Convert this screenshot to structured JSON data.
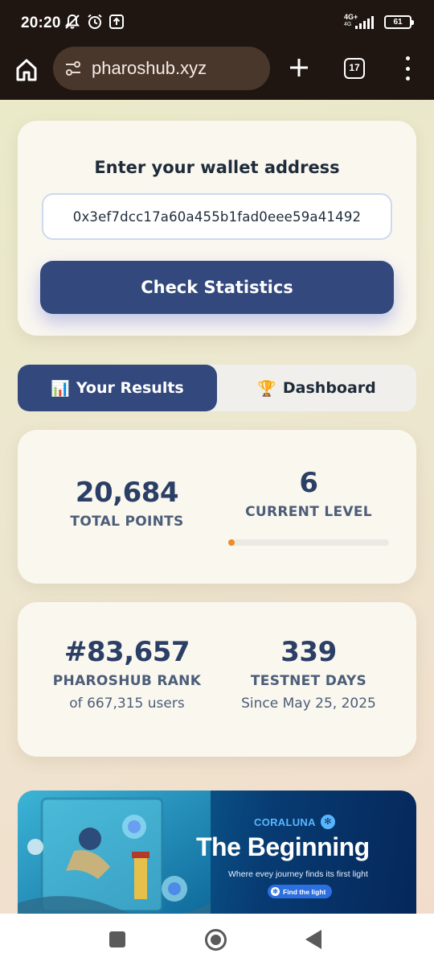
{
  "status_bar": {
    "time": "20:20",
    "network_label": "4G+",
    "network_sub": "4G",
    "battery": "61",
    "icons": [
      "notifications-off-icon",
      "alarm-icon",
      "upload-notification-icon",
      "signal-icon",
      "battery-icon"
    ]
  },
  "browser": {
    "url": "pharoshub.xyz",
    "tab_count": "17",
    "icons": [
      "home-icon",
      "site-settings-icon",
      "plus-icon",
      "tab-switcher-icon",
      "more-menu-icon"
    ]
  },
  "wallet": {
    "title": "Enter your wallet address",
    "address": "0x3ef7dcc17a60a455b1fad0eee59a41492",
    "button_label": "Check Statistics"
  },
  "tabs": [
    {
      "icon": "📊",
      "label": "Your Results",
      "active": true
    },
    {
      "icon": "🏆",
      "label": "Dashboard",
      "active": false
    }
  ],
  "stats": {
    "total_points": {
      "value": "20,684",
      "label": "TOTAL POINTS"
    },
    "current_level": {
      "value": "6",
      "label": "CURRENT LEVEL",
      "progress": 0.02
    },
    "rank": {
      "value": "#83,657",
      "label": "PHAROSHUB RANK",
      "sub": "of 667,315 users"
    },
    "testnet_days": {
      "value": "339",
      "label": "TESTNET DAYS",
      "sub": "Since May 25, 2025"
    }
  },
  "banner": {
    "brand": "CORALUNA",
    "title": "The Beginning",
    "tagline": "Where evey journey finds its first  light",
    "button_label": "Find the light"
  },
  "colors": {
    "primary": "#33497d",
    "accent": "#f08a24",
    "text": "#1e2b3a",
    "card": "#faf7ef",
    "browser_bar": "#1f1612"
  }
}
